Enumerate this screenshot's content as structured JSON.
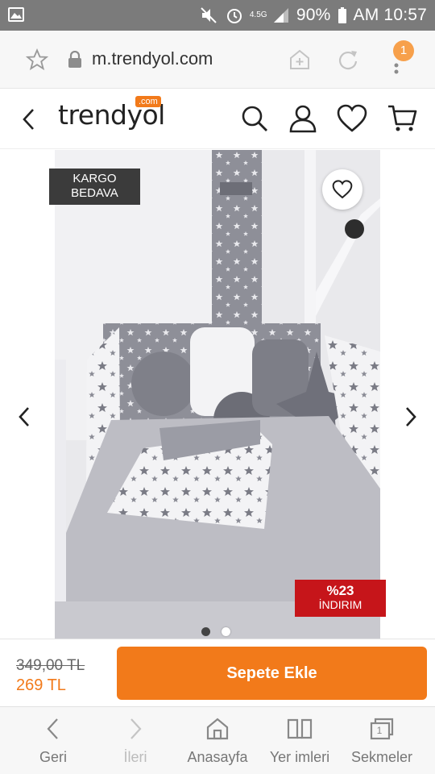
{
  "status_bar": {
    "network": "4.5G",
    "battery": "90%",
    "time": "AM 10:57"
  },
  "browser": {
    "url": "m.trendyol.com",
    "menu_badge": "1",
    "icons": [
      "bookmark-star-icon",
      "lock-icon",
      "add-page-icon",
      "reload-icon",
      "menu-icon"
    ]
  },
  "site_header": {
    "logo": "trendyol",
    "logo_suffix": ".com",
    "icons": [
      "back-arrow-icon",
      "search-icon",
      "user-icon",
      "heart-icon",
      "cart-icon"
    ]
  },
  "product": {
    "badge_shipping": "KARGO BEDAVA",
    "badge_shipping_line1": "KARGO",
    "badge_shipping_line2": "BEDAVA",
    "discount_pct": "%23",
    "discount_label": "İNDIRIM",
    "gallery_total": 2,
    "gallery_active": 1
  },
  "price": {
    "old": "349,00 TL",
    "new": "269 TL",
    "add_to_cart": "Sepete Ekle"
  },
  "bottom_nav": {
    "items": [
      {
        "label": "Geri",
        "enabled": true
      },
      {
        "label": "İleri",
        "enabled": false
      },
      {
        "label": "Anasayfa",
        "enabled": true
      },
      {
        "label": "Yer imleri",
        "enabled": true
      },
      {
        "label": "Sekmeler",
        "enabled": true,
        "count": "1"
      }
    ]
  },
  "colors": {
    "brand_orange": "#f27a1a",
    "discount_red": "#c6151a",
    "status_bar": "#7b7b7b",
    "badge_dark": "#3b3b3b"
  }
}
